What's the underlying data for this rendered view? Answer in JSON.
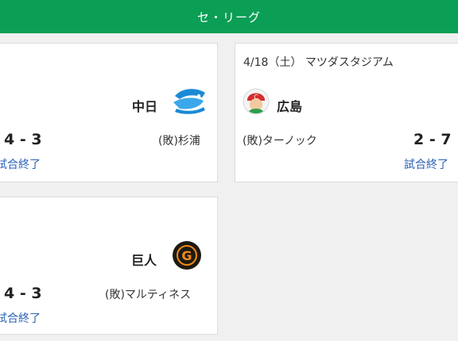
{
  "league": {
    "title": "セ・リーグ"
  },
  "games": [
    {
      "team": "中日",
      "team_logo": "dragons-logo",
      "pitcher": "(敗)杉浦",
      "score": "4 - 3",
      "status": "試合終了"
    },
    {
      "venue": "4/18（土） マツダスタジアム",
      "team": "広島",
      "team_logo": "carp-logo",
      "pitcher": "(敗)ターノック",
      "score": "2 - 7",
      "status": "試合終了"
    },
    {
      "team": "巨人",
      "team_logo": "giants-logo",
      "pitcher": "(敗)マルティネス",
      "score": "4 - 3",
      "status": "試合終了"
    }
  ],
  "colors": {
    "league_header": "#0b9e55",
    "status_link": "#2a61b5",
    "card_border": "#dcdcdc"
  }
}
